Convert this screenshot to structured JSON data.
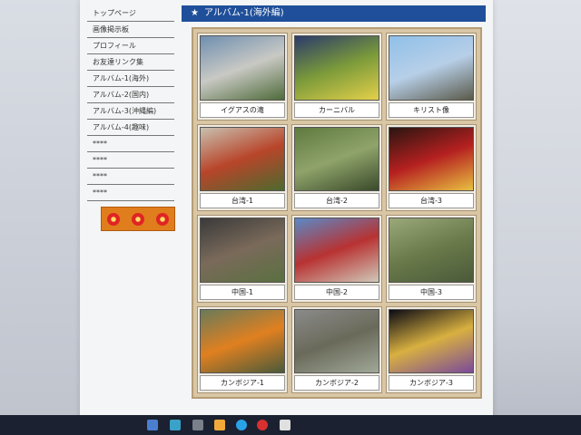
{
  "nav": {
    "items": [
      "トップページ",
      "画像掲示板",
      "プロフィール",
      "お友達リンク集",
      "アルバム-1(海外)",
      "アルバム-2(国内)",
      "アルバム-3(沖縄編)",
      "アルバム-4(趣味)",
      "****",
      "****",
      "****",
      "****"
    ]
  },
  "main": {
    "title": "アルバム-1(海外編)"
  },
  "album": [
    {
      "caption": "イグアスの滝",
      "colors": [
        "#6f8fb0",
        "#c9c9c4",
        "#4f6b3a"
      ]
    },
    {
      "caption": "カーニバル",
      "colors": [
        "#2a3b6a",
        "#7b9a3a",
        "#e3d04a"
      ]
    },
    {
      "caption": "キリスト像",
      "colors": [
        "#8fc0e8",
        "#b7cfe8",
        "#5a5a4a"
      ]
    },
    {
      "caption": "台湾-1",
      "colors": [
        "#c9c0b0",
        "#b8452a",
        "#4c6a2e"
      ]
    },
    {
      "caption": "台湾-2",
      "colors": [
        "#5e7a3e",
        "#8fa36a",
        "#3a4a2a"
      ]
    },
    {
      "caption": "台湾-3",
      "colors": [
        "#2a1510",
        "#b52020",
        "#e8c040"
      ]
    },
    {
      "caption": "中国-1",
      "colors": [
        "#3a3a3a",
        "#7a6a5a",
        "#5a7040"
      ]
    },
    {
      "caption": "中国-2",
      "colors": [
        "#5a8ac8",
        "#b83232",
        "#d0c8b8"
      ]
    },
    {
      "caption": "中国-3",
      "colors": [
        "#9aa87a",
        "#6a7a4a",
        "#4a5a3a"
      ]
    },
    {
      "caption": "カンボジア-1",
      "colors": [
        "#6a7a5a",
        "#e08020",
        "#4a5a3a"
      ]
    },
    {
      "caption": "カンボジア-2",
      "colors": [
        "#8a8a8a",
        "#6a6a5a",
        "#a0a898"
      ]
    },
    {
      "caption": "カンボジア-3",
      "colors": [
        "#0a0a14",
        "#d8b040",
        "#7a4a9a"
      ]
    }
  ]
}
